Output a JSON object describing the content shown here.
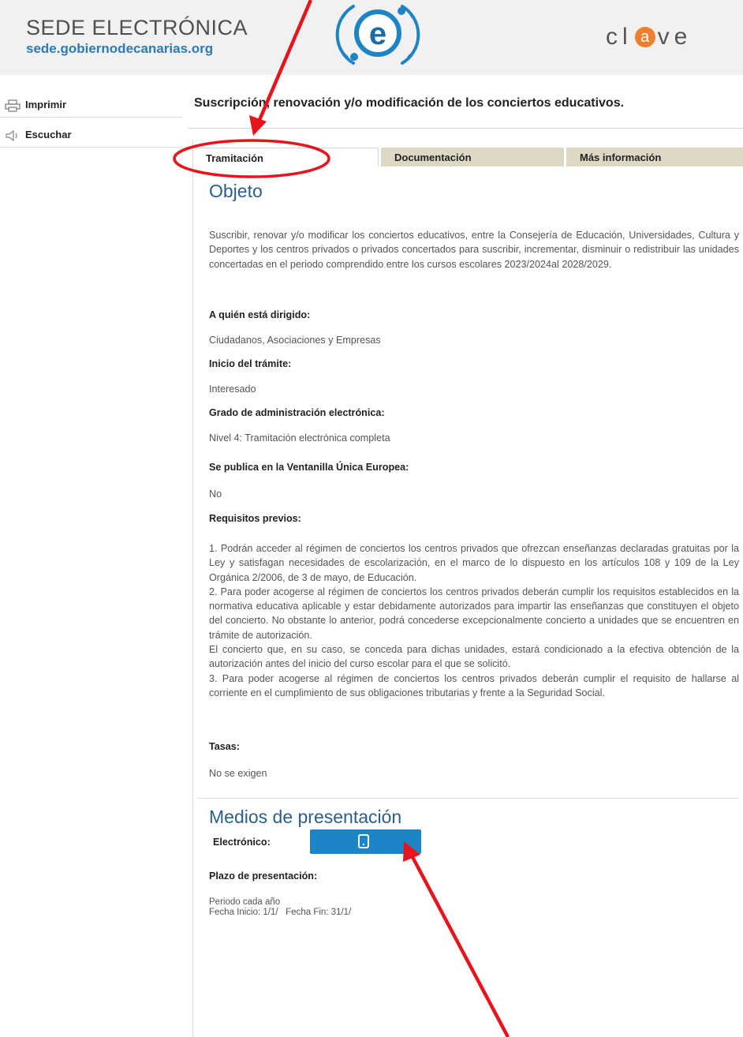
{
  "header": {
    "title": "SEDE ELECTRÓNICA",
    "url": "sede.gobiernodecanarias.org",
    "emblem_letter": "e",
    "clave_prefix": "cl",
    "clave_at": "a",
    "clave_suffix": "ve"
  },
  "sidebar": {
    "print_label": "Imprimir",
    "listen_label": "Escuchar"
  },
  "main": {
    "page_title": "Suscripción, renovación y/o modificación de los conciertos educativos.",
    "tabs": [
      {
        "label": "Tramitación"
      },
      {
        "label": "Documentación"
      },
      {
        "label": "Más información"
      }
    ],
    "objeto_heading": "Objeto",
    "objeto_text": "Suscribir, renovar y/o modificar los conciertos educativos, entre la Consejería de Educación, Universidades, Cultura y Deportes y los centros privados o privados concertados para suscribir, incrementar, disminuir o redistribuir las unidades concertadas en el periodo comprendido entre los cursos escolares 2023/2024al 2028/2029.",
    "fields": {
      "dirigido_label": "A quién está dirigido:",
      "dirigido_value": "Ciudadanos, Asociaciones y Empresas",
      "inicio_label": "Inicio del trámite:",
      "inicio_value": "Interesado",
      "grado_label": "Grado de administración electrónica:",
      "grado_value": "Nivel 4: Tramitación electrónica completa",
      "ventanilla_label": "Se publica en la Ventanilla Única Europea:",
      "ventanilla_value": "No",
      "requisitos_label": "Requisitos previos:",
      "tasas_label": "Tasas:",
      "tasas_value": "No se exigen"
    },
    "requisitos": [
      "1. Podrán acceder al régimen de conciertos los centros privados que ofrezcan enseñanzas declaradas gratuitas por la Ley y satisfagan necesidades de escolarización, en el marco de lo dispuesto en los artículos 108 y 109 de la Ley Orgánica 2/2006, de 3 de mayo, de Educación.",
      "2. Para poder acogerse al régimen de conciertos los centros privados deberán cumplir los requisitos establecidos en la normativa educativa aplicable y estar debidamente autorizados para impartir las enseñanzas que constituyen el objeto del concierto. No obstante lo anterior, podrá concederse excepcionalmente concierto a unidades que se encuentren en trámite de autorización.",
      "El concierto que, en su caso, se conceda para dichas unidades, estará condicionado a la efectiva obtención de la autorización antes del inicio del curso escolar para el que se solicitó.",
      "3. Para poder acogerse al régimen de conciertos los centros privados deberán cumplir el requisito de hallarse al corriente en el cumplimiento de sus obligaciones tributarias y frente a la Seguridad Social."
    ],
    "medios_heading": "Medios de presentación",
    "electronico_label": "Electrónico:",
    "plazo_label": "Plazo de presentación:",
    "plazo_line1": "Periodo cada año",
    "plazo_line2": "Fecha Inicio: 1/1/   Fecha Fin: 31/1/"
  },
  "colors": {
    "accent_blue": "#1d84c6",
    "heading_blue": "#2b5d8d",
    "annotation_red": "#e8141b",
    "tab_inactive": "#ddd8c3"
  }
}
